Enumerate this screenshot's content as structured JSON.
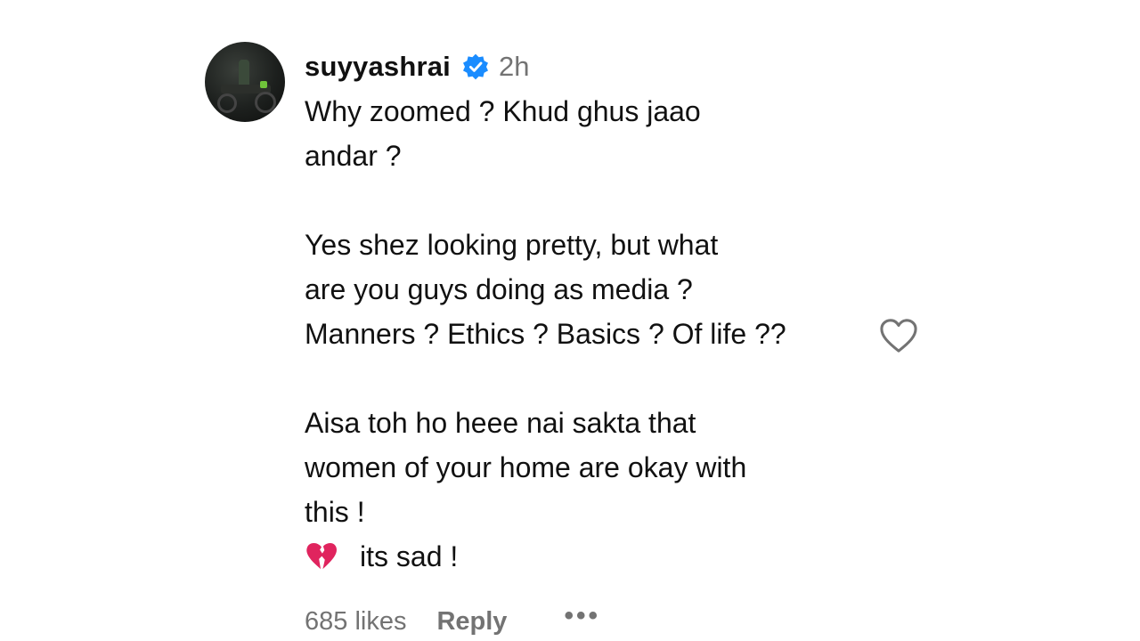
{
  "comment": {
    "username": "suyyashrai",
    "time": "2h",
    "lines": [
      "Why zoomed ? Khud ghus jaao",
      "andar ?",
      "",
      "Yes shez looking pretty, but what",
      "are you guys doing as media ?",
      "Manners ? Ethics ? Basics ? Of life ??",
      "",
      "Aisa toh ho heee nai sakta that",
      "women of your home are okay with",
      "this !"
    ],
    "last_line_text": "its sad !",
    "last_line_icon": "broken-heart-icon",
    "likes": "685 likes",
    "reply_label": "Reply",
    "more_label": "•••"
  },
  "colors": {
    "verified_badge": "#1a8cff",
    "meta_text": "#737373",
    "broken_heart": "#e0245e"
  }
}
